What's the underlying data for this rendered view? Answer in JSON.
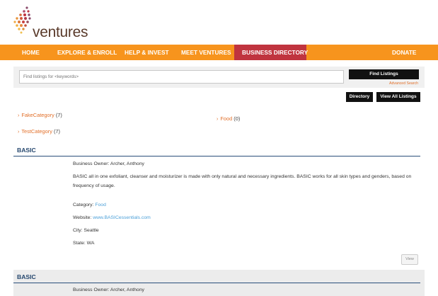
{
  "brand": {
    "logo_text": "ventures",
    "colors": {
      "orange": "#f7941d",
      "red": "#c0343f",
      "navy": "#25476e",
      "link_blue": "#4a9fd8",
      "link_orange": "#e2702a"
    }
  },
  "nav": {
    "items": [
      {
        "label": "HOME"
      },
      {
        "label": "EXPLORE & ENROLL"
      },
      {
        "label": "HELP & INVEST"
      },
      {
        "label": "MEET VENTURES"
      },
      {
        "label": "BUSINESS DIRECTORY",
        "active": true
      },
      {
        "label": "DONATE"
      }
    ]
  },
  "search": {
    "placeholder": "Find listings for <keywords>",
    "submit_label": "Find Listings",
    "advanced_label": "Advanced Search"
  },
  "view_buttons": {
    "directory": "Directory",
    "all_listings": "View All Listings"
  },
  "categories": [
    {
      "name": "FakeCategory",
      "count": "(7)"
    },
    {
      "name": "TestCategory",
      "count": "(7)"
    },
    {
      "name": "Food",
      "count": "(0)"
    }
  ],
  "listings": [
    {
      "title": "BASIC",
      "owner_label": "Business Owner:",
      "owner": "Archer, Anthony",
      "description": "BASIC all in one exfoliant, cleanser and moisturizer is made with only natural and necessary ingredients. BASIC works for all skin types and genders, based on frequency of usage.",
      "category_label": "Category:",
      "category": "Food",
      "website_label": "Website:",
      "website": "www.BASICessentials.com",
      "city_label": "City:",
      "city": "Seattle",
      "state_label": "State:",
      "state": "WA",
      "view_label": "View"
    },
    {
      "title": "BASIC",
      "owner_label": "Business Owner:",
      "owner": "Archer, Anthony"
    }
  ]
}
